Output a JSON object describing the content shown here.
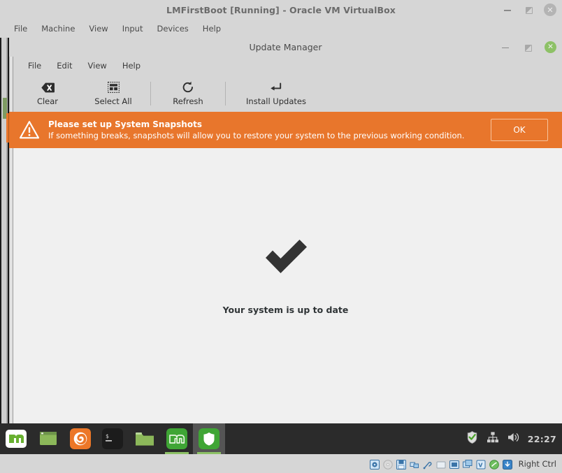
{
  "host_window": {
    "title": "LMFirstBoot [Running] - Oracle VM VirtualBox",
    "controls": [
      {
        "name": "minimize",
        "label": "–"
      },
      {
        "name": "restore",
        "label": ""
      },
      {
        "name": "close",
        "label": "✕"
      }
    ],
    "menus": [
      "File",
      "Machine",
      "View",
      "Input",
      "Devices",
      "Help"
    ]
  },
  "update_manager": {
    "title": "Update Manager",
    "menus": [
      "File",
      "Edit",
      "View",
      "Help"
    ],
    "controls": [
      {
        "name": "minimize",
        "label": "–"
      },
      {
        "name": "restore",
        "label": ""
      },
      {
        "name": "close",
        "label": "✕"
      }
    ],
    "toolbar": [
      {
        "label": "Clear",
        "icon": "clear-backspace-icon"
      },
      {
        "label": "Select All",
        "icon": "select-all-grid-icon"
      },
      {
        "label": "Refresh",
        "icon": "refresh-circular-arrow-icon"
      },
      {
        "label": "Install Updates",
        "icon": "install-updates-enter-arrow-icon"
      }
    ],
    "banner": {
      "title": "Please set up System Snapshots",
      "subtitle": "If something breaks, snapshots will allow you to restore your system to the previous working condition.",
      "button_label": "OK",
      "icon": "warning-triangle-icon",
      "background_color": "#e8762c",
      "text_color": "#ffffff"
    },
    "status": {
      "message": "Your system is up to date",
      "icon": "checkmark-icon",
      "icon_color": "#333333"
    }
  },
  "taskbar": {
    "items": [
      {
        "name": "menu-mint-button",
        "icon": "linux-mint-menu-icon"
      },
      {
        "name": "show-desktop-button",
        "icon": "window-icon"
      },
      {
        "name": "firefox-launcher",
        "icon": "firefox-icon"
      },
      {
        "name": "terminal-launcher",
        "icon": "terminal-icon"
      },
      {
        "name": "files-launcher",
        "icon": "folder-icon"
      },
      {
        "name": "software-manager-window",
        "icon": "linux-mint-icon"
      },
      {
        "name": "update-manager-window",
        "icon": "shield-icon"
      }
    ],
    "tray": [
      {
        "name": "update-manager-tray",
        "icon": "shield-check-icon"
      },
      {
        "name": "network-tray",
        "icon": "network-icon"
      },
      {
        "name": "volume-tray",
        "icon": "volume-icon"
      }
    ],
    "clock": "22:27"
  },
  "vbox_statusbar": {
    "icons": [
      "hard-disk-icon",
      "optical-disk-icon",
      "floppy-disk-icon",
      "network-adapter-icon",
      "usb-icon",
      "shared-folders-icon",
      "display-icon",
      "recording-icon",
      "virtualization-icon",
      "mouse-integration-icon",
      "keyboard-icon"
    ],
    "host_key": "Right Ctrl"
  }
}
